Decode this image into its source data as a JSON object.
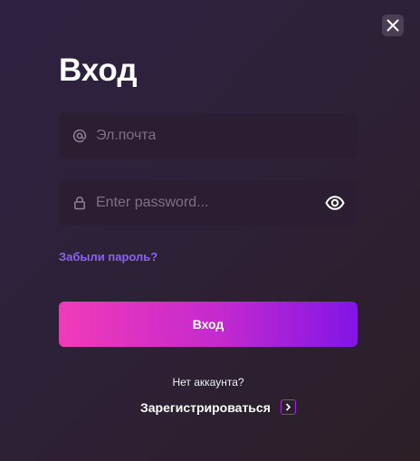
{
  "dialog": {
    "title": "Вход",
    "close_icon": "close-icon"
  },
  "email": {
    "value": "",
    "placeholder": "Эл.почта",
    "icon": "at-icon"
  },
  "password": {
    "value": "",
    "placeholder": "Enter password...",
    "icon": "lock-icon",
    "toggle_icon": "eye-icon"
  },
  "forgot_password": {
    "label": "Забыли пароль?"
  },
  "submit": {
    "label": "Вход"
  },
  "signup": {
    "prompt": "Нет аккаунта?",
    "label": "Зарегистрироваться",
    "icon": "chevron-right-icon"
  },
  "colors": {
    "background_start": "#2f2143",
    "background_end": "#2c1f27",
    "field_background": "#2b1e32",
    "link": "#8a63f0",
    "button_gradient_start": "#f23ab8",
    "button_gradient_end": "#8215e6",
    "arrow_border": "#a62bd6"
  }
}
